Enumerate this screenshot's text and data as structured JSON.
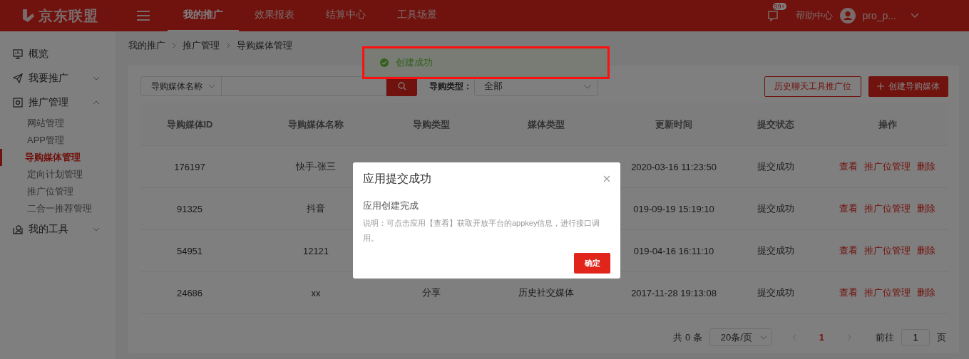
{
  "header": {
    "logo": "京东联盟",
    "nav": [
      {
        "label": "我的推广",
        "selected": true
      },
      {
        "label": "效果报表",
        "selected": false
      },
      {
        "label": "结算中心",
        "selected": false
      },
      {
        "label": "工具场景",
        "selected": false
      }
    ],
    "badge": "99+",
    "help": "帮助中心",
    "user": "pro_p..."
  },
  "sidebar": {
    "items": [
      {
        "label": "概览"
      },
      {
        "label": "我要推广",
        "expanded": false
      },
      {
        "label": "推广管理",
        "expanded": true,
        "children": [
          {
            "label": "网站管理",
            "selected": false
          },
          {
            "label": "APP管理",
            "selected": false
          },
          {
            "label": "导购媒体管理",
            "selected": true
          },
          {
            "label": "定向计划管理",
            "selected": false
          },
          {
            "label": "推广位管理",
            "selected": false
          },
          {
            "label": "二合一推荐管理",
            "selected": false
          }
        ]
      },
      {
        "label": "我的工具",
        "expanded": false
      }
    ]
  },
  "breadcrumb": [
    "我的推广",
    "推广管理",
    "导购媒体管理"
  ],
  "toast": {
    "text": "创建成功"
  },
  "filters": {
    "search_select": "导购媒体名称",
    "type_label": "导购类型：",
    "type_value": "全部"
  },
  "buttons": [
    {
      "label": "历史聊天工具推广位",
      "kind": "outline"
    },
    {
      "label": "创建导购媒体",
      "kind": "primary"
    }
  ],
  "table": {
    "columns": [
      "导购媒体ID",
      "导购媒体名称",
      "导购类型",
      "媒体类型",
      "更新时间",
      "提交状态",
      "操作"
    ],
    "rows": [
      {
        "cells": [
          "176197",
          "快手-张三",
          null,
          null,
          "2020-03-16 11:23:50",
          "提交成功"
        ],
        "actions": [
          "查看",
          "推广位管理",
          "删除"
        ]
      },
      {
        "cells": [
          "91325",
          "抖音",
          null,
          null,
          "019-09-19 15:19:10",
          "提交成功"
        ],
        "actions": [
          "查看",
          "推广位管理",
          "删除"
        ]
      },
      {
        "cells": [
          "54951",
          "12121",
          null,
          null,
          "019-04-16 16:11:10",
          "提交成功"
        ],
        "actions": [
          "查看",
          "推广位管理",
          "删除"
        ]
      },
      {
        "cells": [
          "24686",
          "xx",
          "分享",
          "历史社交媒体",
          "2017-11-28 19:13:08",
          "提交成功"
        ],
        "actions": [
          "查看",
          "推广位管理",
          "删除"
        ]
      }
    ]
  },
  "pagination": {
    "total": "共 0 条",
    "page_size": "20条/页",
    "pages": [
      {
        "label": "1",
        "selected": true
      }
    ],
    "goto": "前往",
    "goto_value": "1",
    "unit": "页"
  },
  "modal": {
    "title": "应用提交成功",
    "heading": "应用创建完成",
    "note": "说明：可点击应用【查看】获取开放平台的appkey信息，进行接口调用。",
    "button": "确定"
  }
}
